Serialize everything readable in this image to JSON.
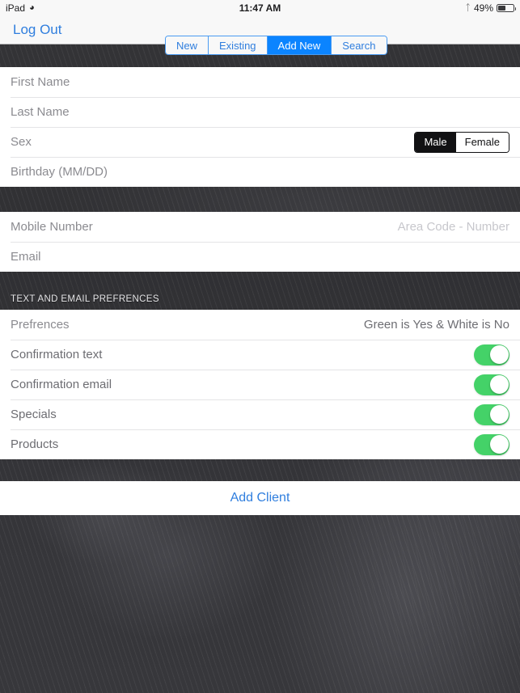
{
  "status_bar": {
    "device": "iPad",
    "wifi_icon": "wifi-icon",
    "time": "11:47 AM",
    "bluetooth_icon": "bluetooth-icon",
    "battery_percent": "49%"
  },
  "nav": {
    "logout_label": "Log Out",
    "segments": [
      {
        "label": "New",
        "selected": false
      },
      {
        "label": "Existing",
        "selected": false
      },
      {
        "label": "Add New",
        "selected": true
      },
      {
        "label": "Search",
        "selected": false
      }
    ],
    "selected_color": "#0b84ff",
    "tint_color": "#2f7ede"
  },
  "personal_group": {
    "rows": [
      {
        "label": "First Name",
        "value": ""
      },
      {
        "label": "Last Name",
        "value": ""
      },
      {
        "label": "Sex",
        "value": ""
      },
      {
        "label": "Birthday (MM/DD)",
        "value": ""
      }
    ],
    "sex_options": [
      {
        "label": "Male",
        "selected": true
      },
      {
        "label": "Female",
        "selected": false
      }
    ]
  },
  "contact_group": {
    "rows": [
      {
        "label": "Mobile Number",
        "placeholder": "Area Code - Number"
      },
      {
        "label": "Email",
        "placeholder": ""
      }
    ]
  },
  "preferences_section": {
    "header": "TEXT AND EMAIL PREFRENCES",
    "legend_label": "Prefrences",
    "legend_hint": "Green is Yes & White is No",
    "toggle_on_color": "#44d268",
    "toggles": [
      {
        "label": "Confirmation text",
        "on": true
      },
      {
        "label": "Confirmation email",
        "on": true
      },
      {
        "label": "Specials",
        "on": true
      },
      {
        "label": "Products",
        "on": true
      }
    ]
  },
  "footer": {
    "add_client_label": "Add Client"
  }
}
